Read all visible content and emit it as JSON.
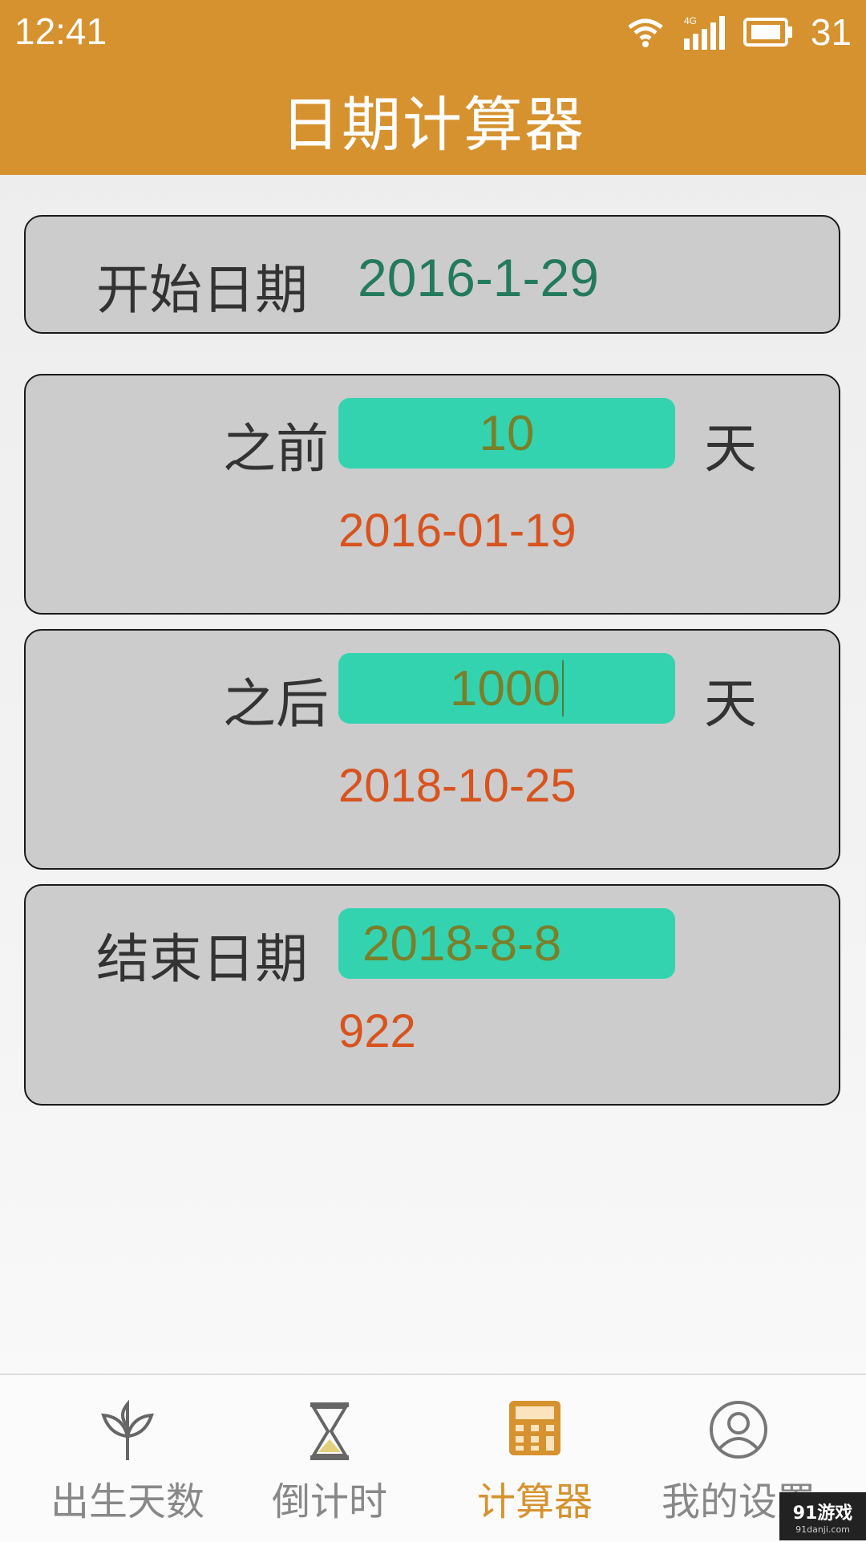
{
  "status_bar": {
    "time": "12:41",
    "battery": "31",
    "network": "4G"
  },
  "header": {
    "title": "日期计算器"
  },
  "start_card": {
    "label": "开始日期",
    "value": "2016-1-29"
  },
  "before_card": {
    "label": "之前",
    "days": "10",
    "unit": "天",
    "result": "2016-01-19"
  },
  "after_card": {
    "label": "之后",
    "days": "1000",
    "unit": "天",
    "result": "2018-10-25"
  },
  "end_card": {
    "label": "结束日期",
    "value": "2018-8-8",
    "result": "922"
  },
  "tabs": [
    {
      "label": "出生天数",
      "icon": "sprout-icon"
    },
    {
      "label": "倒计时",
      "icon": "hourglass-icon"
    },
    {
      "label": "计算器",
      "icon": "calculator-icon",
      "active": true
    },
    {
      "label": "我的设置",
      "icon": "user-icon"
    }
  ],
  "watermark": {
    "text": "91游戏",
    "url": "91danji.com"
  },
  "colors": {
    "accent": "#d6922f",
    "input_bg": "#34d3b0",
    "result": "#d8531e",
    "start_value": "#237a5c",
    "card_bg": "#cccccc"
  }
}
